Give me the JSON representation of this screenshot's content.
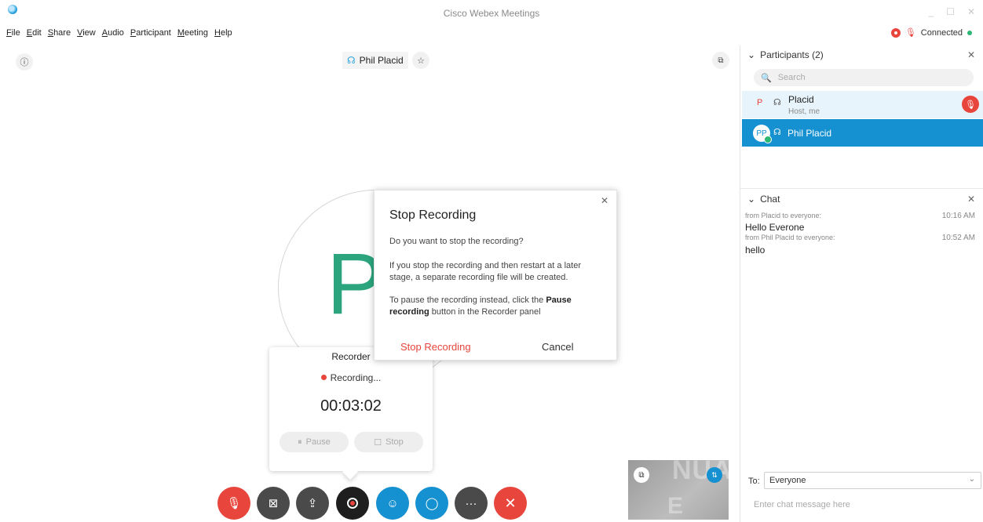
{
  "window": {
    "title": "Cisco Webex Meetings",
    "controls": [
      "_",
      "☐",
      "✕"
    ]
  },
  "menu": [
    "File",
    "Edit",
    "Share",
    "View",
    "Audio",
    "Participant",
    "Meeting",
    "Help"
  ],
  "status": {
    "connection": "Connected",
    "connection_color": "#2bb673"
  },
  "stage": {
    "speaker_name": "Phil Placid",
    "avatar_letter": "P"
  },
  "recorder": {
    "title": "Recorder",
    "status": "Recording...",
    "elapsed": "00:03:02",
    "pause_label": "Pause",
    "stop_label": "Stop"
  },
  "dialog": {
    "title": "Stop Recording",
    "question": "Do you want to stop the recording?",
    "info": "If you stop the recording and then restart at a later stage, a separate recording file will be created.",
    "pause_hint_prefix": "To pause the recording instead, click the ",
    "pause_hint_bold": "Pause recording",
    "pause_hint_suffix": " button in the Recorder panel",
    "confirm_label": "Stop Recording",
    "cancel_label": "Cancel"
  },
  "controls": {
    "end_color": "#e8453c",
    "accent_color": "#1590d0"
  },
  "participants": {
    "header": "Participants (2)",
    "search_placeholder": "Search",
    "items": [
      {
        "initials": "P",
        "name": "Placid",
        "role": "Host, me"
      },
      {
        "initials": "PP",
        "name": "Phil Placid"
      }
    ]
  },
  "chat": {
    "header": "Chat",
    "messages": [
      {
        "from": "from Placid to everyone:",
        "time": "10:16 AM",
        "text": "Hello Everone"
      },
      {
        "from": "from Phil Placid to everyone:",
        "time": "10:52 AM",
        "text": "hello"
      }
    ],
    "to_label": "To:",
    "to_value": "Everyone",
    "input_placeholder": "Enter chat message here"
  }
}
